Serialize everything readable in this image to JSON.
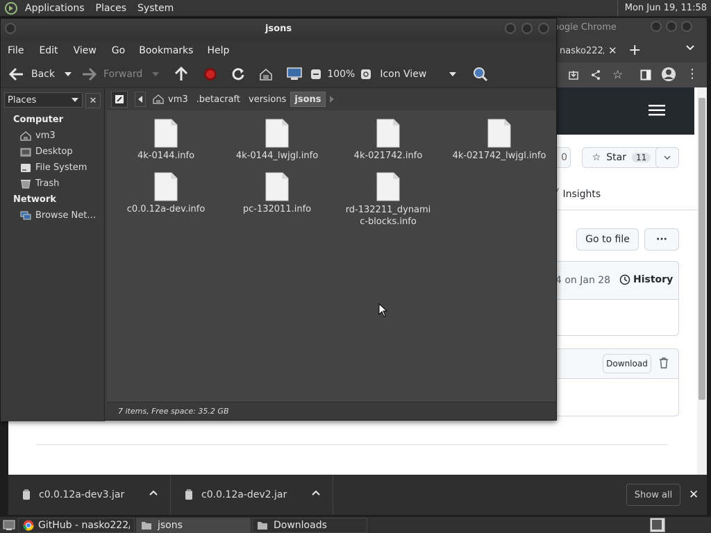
{
  "top_panel": {
    "menus": [
      "Applications",
      "Places",
      "System"
    ],
    "clock": "Mon Jun 19, 11:58"
  },
  "chrome": {
    "title_fragment": "oogle Chrome",
    "tab_fragment": "nasko222/",
    "star_label": "Star",
    "star_count": "11",
    "partial_count": "0",
    "insights_label": "Insights",
    "go_to_file": "Go to file",
    "more": "···",
    "commit_fragment": "4 on Jan 28",
    "history_label": "History",
    "download_label": "Download",
    "downloads": [
      {
        "name": "c0.0.12a-dev3.jar"
      },
      {
        "name": "c0.0.12a-dev2.jar"
      }
    ],
    "show_all": "Show all"
  },
  "nautilus": {
    "title": "jsons",
    "menu": [
      "File",
      "Edit",
      "View",
      "Go",
      "Bookmarks",
      "Help"
    ],
    "toolbar": {
      "back": "Back",
      "forward": "Forward",
      "zoom": "100%",
      "view_mode": "Icon View"
    },
    "sidebar": {
      "combo": "Places",
      "computer_header": "Computer",
      "computer_items": [
        "vm3",
        "Desktop",
        "File System",
        "Trash"
      ],
      "network_header": "Network",
      "network_items": [
        "Browse Net…"
      ]
    },
    "path": [
      "vm3",
      ".betacraft",
      "versions",
      "jsons"
    ],
    "files": [
      "4k-0144.info",
      "4k-0144_lwjgl.info",
      "4k-021742.info",
      "4k-021742_lwjgl.info",
      "c0.0.12a-dev.info",
      "pc-132011.info",
      "rd-132211_dynamic-blocks.info"
    ],
    "status": "7 items, Free space: 35.2 GB"
  },
  "taskbar": {
    "items": [
      "GitHub - nasko222/…",
      "jsons",
      "Downloads"
    ]
  }
}
